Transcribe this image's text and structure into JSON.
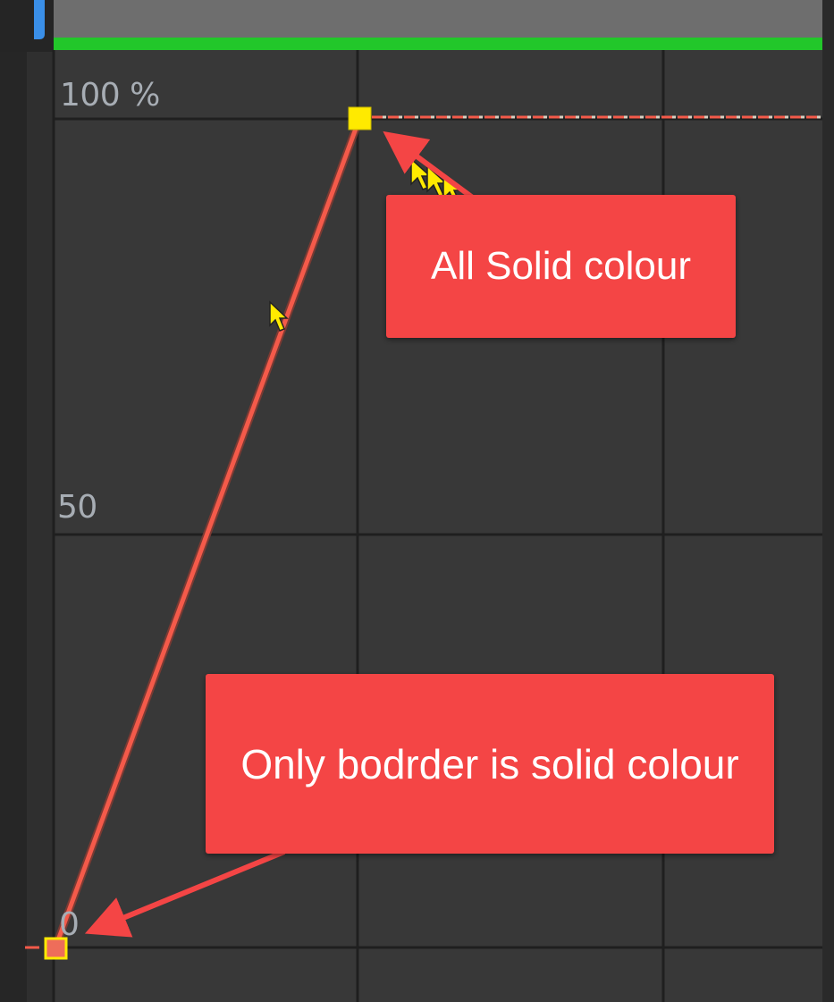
{
  "graph": {
    "y_labels": {
      "top": "100 %",
      "middle": "50",
      "bottom": "0"
    },
    "keyframes": [
      {
        "name": "keyframe-start",
        "value_percent": 0,
        "fill": "border-only"
      },
      {
        "name": "keyframe-end",
        "value_percent": 100,
        "fill": "solid"
      }
    ],
    "colors": {
      "background": "#383838",
      "grid_line": "#1f1f1f",
      "curve": "#f45a4a",
      "keyframe": "#ffea00",
      "progress_bar": "#22c72a",
      "playhead": "#3a8fe8"
    }
  },
  "annotations": {
    "solid": "All Solid colour",
    "border": "Only bodrder is solid colour",
    "color": "#f44545"
  }
}
